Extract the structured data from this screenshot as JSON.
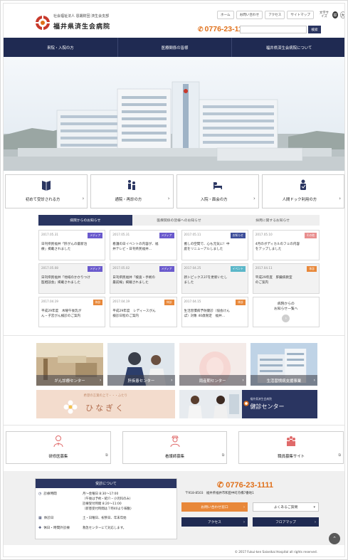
{
  "header": {
    "corp_line": "社会福祉法人 恩賜財団 済生会支部",
    "hospital_name": "福井県済生会病院",
    "top_links": [
      "ホーム",
      "お問い合わせ",
      "アクセス",
      "サイトマップ"
    ],
    "font_size_label": "文字サイズ",
    "font_size_buttons": [
      "標",
      "大"
    ],
    "phone": "0776-23-1111",
    "search_placeholder": "",
    "search_button": "検索"
  },
  "nav": {
    "items": [
      "来院・入院の方",
      "医療関係の皆様",
      "福井県済生会病院について"
    ]
  },
  "quick_links": [
    {
      "label": "初めて受診される方",
      "icon": "guide-icon"
    },
    {
      "label": "通院・再診の方",
      "icon": "outpatient-icon"
    },
    {
      "label": "入院・面会の方",
      "icon": "inpatient-icon"
    },
    {
      "label": "人間ドック利用の方",
      "icon": "checkup-icon"
    }
  ],
  "news": {
    "tabs": [
      "病院からのお知らせ",
      "医療関係の皆様へのお知らせ",
      "採用に関するお知らせ"
    ],
    "active_tab": 0,
    "items": [
      {
        "date": "2017.05.31",
        "badge": "メディア",
        "badge_color": "#6a5acd",
        "text": "日刊県民福井「肝がんの最新治\n療」掲載されました",
        "gray": false
      },
      {
        "date": "2017.05.31",
        "badge": "メディア",
        "badge_color": "#6a5acd",
        "text": "看護の日イベントの内容が、福\n井テレビ・日刊県民福井...",
        "gray": false
      },
      {
        "date": "2017.05.11",
        "badge": "お知らせ",
        "badge_color": "#3d4e9a",
        "text": "癒しの空間で、心も元気に！中\n庭をリニューアルしました",
        "gray": false
      },
      {
        "date": "2017.05.10",
        "badge": "その他",
        "badge_color": "#e88e8e",
        "text": "4月のボディカルのフェの内容\nをアップしました",
        "gray": false
      },
      {
        "date": "2017.05.08",
        "badge": "メディア",
        "badge_color": "#6a5acd",
        "text": "日刊県民福井「地域のかかりつけ\n医相談会」掲載されました",
        "gray": true
      },
      {
        "date": "2017.05.02",
        "badge": "メディア",
        "badge_color": "#6a5acd",
        "text": "日刊県民福井「検査・手術の\n最前線」掲載されました",
        "gray": true
      },
      {
        "date": "2017.04.25",
        "badge": "イベント",
        "badge_color": "#5bb7c9",
        "text": "新トピックス37を更新いたし\nました",
        "gray": true
      },
      {
        "date": "2017.04.11",
        "badge": "休診",
        "badge_color": "#e8883a",
        "text": "平成29年度　肝臓病教室\nのご案内",
        "gray": true
      },
      {
        "date": "2017.04.19",
        "badge": "休診",
        "badge_color": "#e8883a",
        "text": "平成29年度　木曜午後乳が\nん・子宮がん検診のご案内",
        "gray": false
      },
      {
        "date": "2017.04.19",
        "badge": "休診",
        "badge_color": "#e8883a",
        "text": "平成29年度　レディースがん\n検診日程のご案内",
        "gray": false
      },
      {
        "date": "2017.04.15",
        "badge": "休診",
        "badge_color": "#e8883a",
        "text": "生活習慣病予防健診（協会けん\nぽ）対象 40歳限定　福井...",
        "gray": false
      }
    ],
    "more_label": "病院からの\nお知らせ一覧へ"
  },
  "centers": [
    {
      "label": "がん診療センター"
    },
    {
      "label": "肝疾患センター"
    },
    {
      "label": "周産期センター"
    },
    {
      "label": "生活習慣病支援事業"
    }
  ],
  "banners": {
    "hinagiku_sub": "希望の言葉の上で・・・ふたり",
    "hinagiku_title": "ひなぎく",
    "kenshin_sub": "福井県済生会病院",
    "kenshin_title": "健診センター"
  },
  "recruit": [
    {
      "label": "研修医募集"
    },
    {
      "label": "看護師募集"
    },
    {
      "label": "職員募集サイト"
    }
  ],
  "footer": {
    "hours_title": "受診について",
    "hours_rows": [
      {
        "key": "診療時間",
        "value": "月〜金曜日 8:30〜17:00\n（午後は予約・紹介・小児科のみ）\n診療受付時間 8:20〜11:00\n（新患受付時間は７時40より稼動）"
      },
      {
        "key": "休診日",
        "value": "土・日曜日、祝祭日、年末年始"
      },
      {
        "key": "休日・時間外診療",
        "value": "救急センターにて対応します。"
      }
    ],
    "phone": "0776-23-1111",
    "address": "〒918-8503　福井県福井市和田中町舟橋7番地1",
    "contact_button": "お問い合わせ窓口",
    "faq_select": "よくあるご質問",
    "access_button": "アクセス",
    "floor_button": "フロアマップ",
    "copyright": "© 2017 Fukui-ken Saiseikai Hospital all rights reserved."
  },
  "colors": {
    "navy": "#1f2a52",
    "orange": "#e0701a",
    "contact_orange": "#e8883a"
  }
}
